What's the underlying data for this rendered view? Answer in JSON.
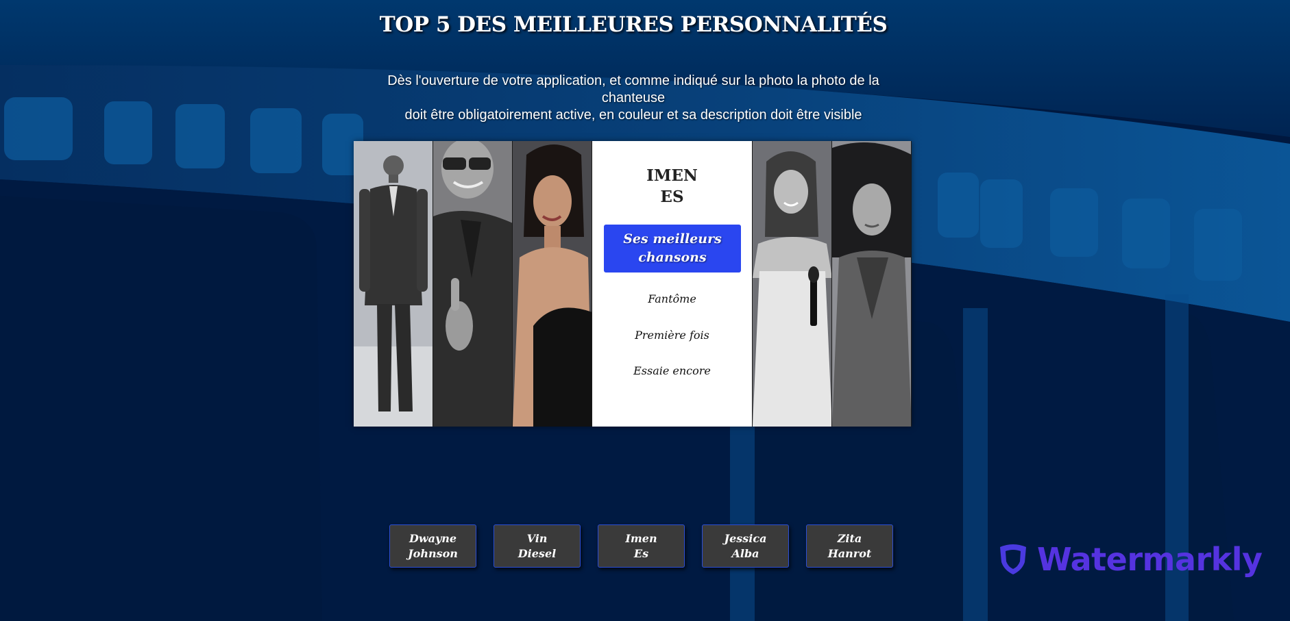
{
  "page": {
    "title": "TOP 5 DES MEILLEURES PERSONNALITÉS",
    "description_line1": "Dès l'ouverture de votre application, et comme indiqué sur la photo la photo de la chanteuse",
    "description_line2": "doit être obligatoirement active, en couleur et sa description doit être visible"
  },
  "gallery": {
    "active_card": {
      "name_line1": "IMEN",
      "name_line2": "ES",
      "songs_button_label": "Ses meilleurs chansons",
      "songs": [
        "Fantôme",
        "Première fois",
        "Essaie encore"
      ]
    }
  },
  "name_buttons": [
    {
      "line1": "Dwayne",
      "line2": "Johnson"
    },
    {
      "line1": "Vin",
      "line2": "Diesel"
    },
    {
      "line1": "Imen",
      "line2": "Es"
    },
    {
      "line1": "Jessica",
      "line2": "Alba"
    },
    {
      "line1": "Zita",
      "line2": "Hanrot"
    }
  ],
  "watermark": {
    "text": "Watermarkly"
  },
  "colors": {
    "background": "#00183f",
    "film_strip": "#0a4a86",
    "accent_button": "#2a46f0",
    "name_button_bg": "#3a3a3a",
    "watermark": "#5533e0"
  }
}
